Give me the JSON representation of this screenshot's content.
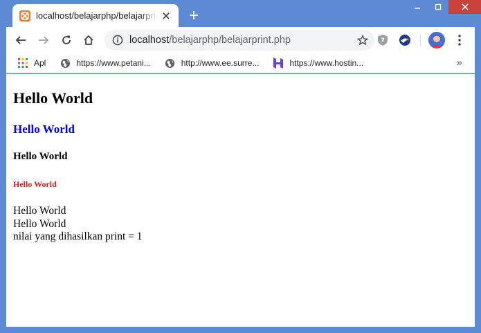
{
  "window": {
    "colors": {
      "frame": "#5d8ad5",
      "close_button": "#c7423a"
    }
  },
  "tab": {
    "title": "localhost/belajarphp/belajarprint.php",
    "favicon": "xampp-icon"
  },
  "toolbar": {
    "url_host": "localhost",
    "url_path": "/belajarphp/belajarprint.php",
    "icons": [
      "back-icon",
      "forward-icon",
      "reload-icon",
      "home-icon",
      "info-icon",
      "star-icon",
      "shield-extension-icon",
      "bird-extension-icon",
      "avatar",
      "menu-icon"
    ]
  },
  "bookmarks": {
    "items": [
      {
        "label": "Apl",
        "icon": "apps-grid-icon"
      },
      {
        "label": "https://www.petani...",
        "icon": "globe-icon"
      },
      {
        "label": "http://www.ee.surre...",
        "icon": "globe-icon"
      },
      {
        "label": "https://www.hostin...",
        "icon": "hostinger-icon"
      }
    ],
    "more": "»"
  },
  "page": {
    "h1": "Hello World",
    "h2": "Hello World",
    "h4": "Hello World",
    "h6": "Hello World",
    "line1": "Hello World",
    "line2": "Hello World",
    "line3": "nilai yang dihasilkan print = 1",
    "colors": {
      "h2": "#0000ee",
      "h6": "#d81b1b"
    }
  }
}
